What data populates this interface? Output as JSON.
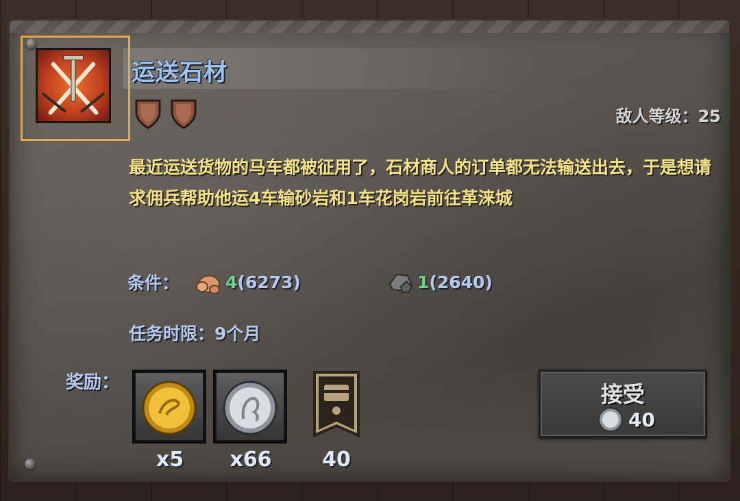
{
  "quest": {
    "title": "运送石材",
    "icon": "crossed-swords-icon",
    "difficulty_shields": 2,
    "enemy_level_label": "敌人等级：",
    "enemy_level_value": "25",
    "description": "最近运送货物的马车都被征用了，石材商人的订单都无法输送出去，于是想请求佣兵帮助他运4车输砂岩和1车花岗岩前往革涞城"
  },
  "conditions": {
    "label": "条件：",
    "items": [
      {
        "icon": "sandstone-icon",
        "required": "4",
        "owned": "(6273)"
      },
      {
        "icon": "granite-icon",
        "required": "1",
        "owned": "(2640)"
      }
    ]
  },
  "deadline": {
    "text": "任务时限：9个月"
  },
  "rewards": {
    "label": "奖励：",
    "items": [
      {
        "icon": "gold-coin-icon",
        "qty": "x5"
      },
      {
        "icon": "silver-coin-icon",
        "qty": "x66"
      },
      {
        "icon": "treasure-banner-icon",
        "qty": "40"
      }
    ]
  },
  "accept_button": {
    "label": "接受",
    "cost_icon": "silver-coin-icon",
    "cost": "40"
  },
  "colors": {
    "title": "#9fc2ee",
    "description": "#f2e28a",
    "required_count": "#6fd08a",
    "icon_highlight": "#e7a453"
  }
}
